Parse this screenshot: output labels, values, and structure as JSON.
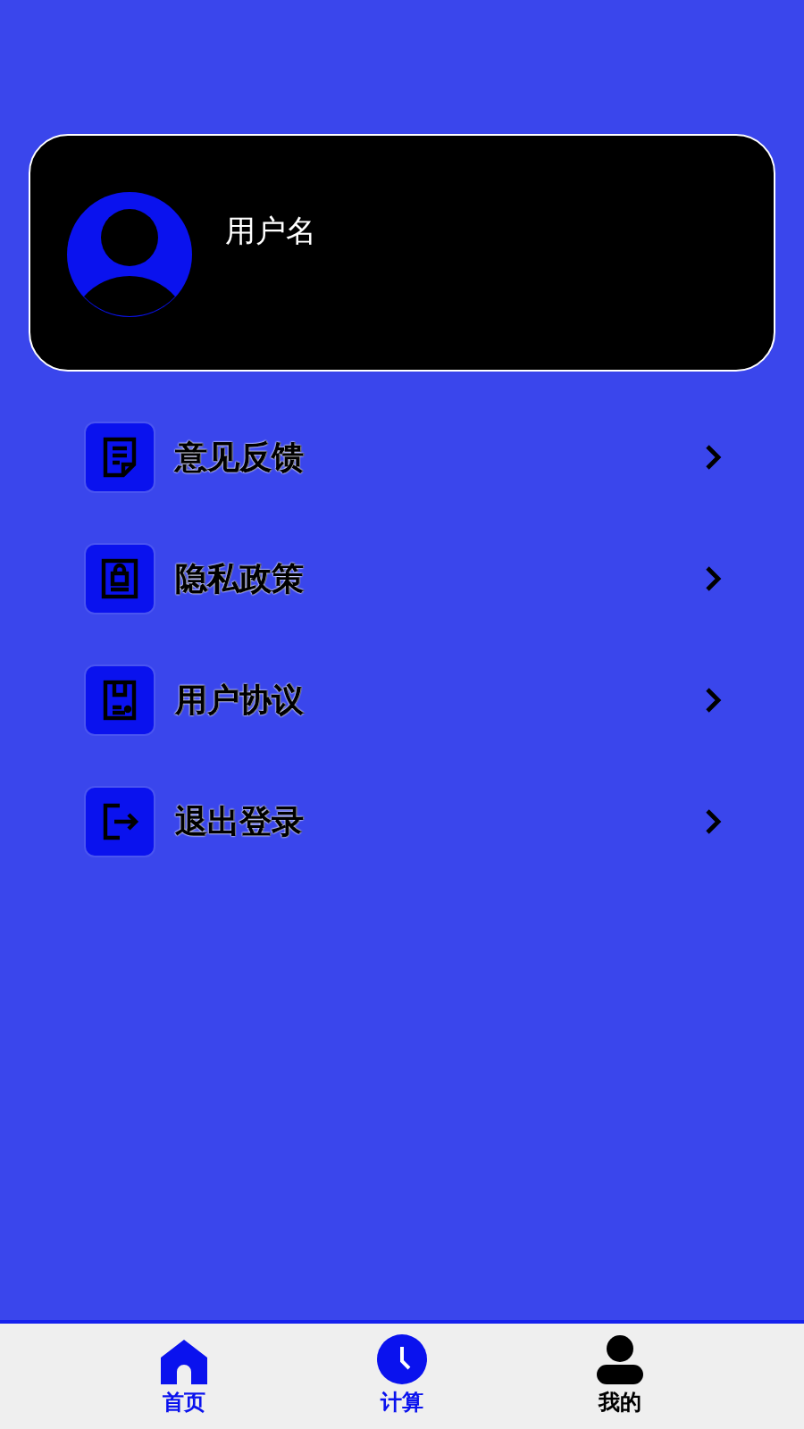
{
  "profile": {
    "username": "用户名"
  },
  "menu": [
    {
      "kind": "feedback",
      "label": "意见反馈"
    },
    {
      "kind": "privacy",
      "label": "隐私政策"
    },
    {
      "kind": "agreement",
      "label": "用户协议"
    },
    {
      "kind": "logout",
      "label": "退出登录"
    }
  ],
  "tabbar": [
    {
      "kind": "home",
      "label": "首页",
      "selected": false
    },
    {
      "kind": "clock",
      "label": "计算",
      "selected": false
    },
    {
      "kind": "person",
      "label": "我的",
      "selected": true
    }
  ]
}
